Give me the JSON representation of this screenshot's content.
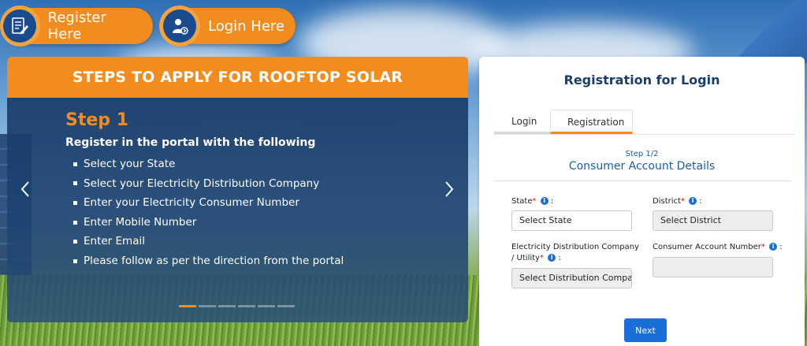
{
  "top_nav": {
    "register_label": "Register Here",
    "login_label": "Login Here",
    "register_icon": "register-form-icon",
    "login_icon": "user-login-icon"
  },
  "steps": {
    "header": "STEPS TO APPLY FOR ROOFTOP SOLAR",
    "step_title": "Step 1",
    "intro": "Register in the portal with the following",
    "items": [
      "Select your State",
      "Select your Electricity Distribution Company",
      "Enter your Electricity Consumer Number",
      "Enter Mobile Number",
      "Enter Email",
      "Please follow as per the direction from the portal"
    ],
    "prev_icon": "chevron-left-icon",
    "next_icon": "chevron-right-icon",
    "active_indicator": 1,
    "indicator_count": 6
  },
  "registration": {
    "title": "Registration for Login",
    "tabs": [
      "Login",
      "Registration"
    ],
    "active_tab": "Registration",
    "step_label": "Step 1/2",
    "section_title": "Consumer Account Details",
    "fields": {
      "state": {
        "label": "State",
        "placeholder": "Select State"
      },
      "district": {
        "label": "District",
        "placeholder": "Select District"
      },
      "utility": {
        "label_line1": "Electricity Distribution Company",
        "label_line2": "/ Utility",
        "placeholder": "Select Distribution Company"
      },
      "consumer_account": {
        "label": "Consumer Account Number",
        "value": ""
      }
    },
    "next_label": "Next"
  },
  "colors": {
    "accent_orange": "#f28c1e",
    "primary_blue": "#1a6ed8",
    "dark_navy": "#1a3f6e"
  }
}
